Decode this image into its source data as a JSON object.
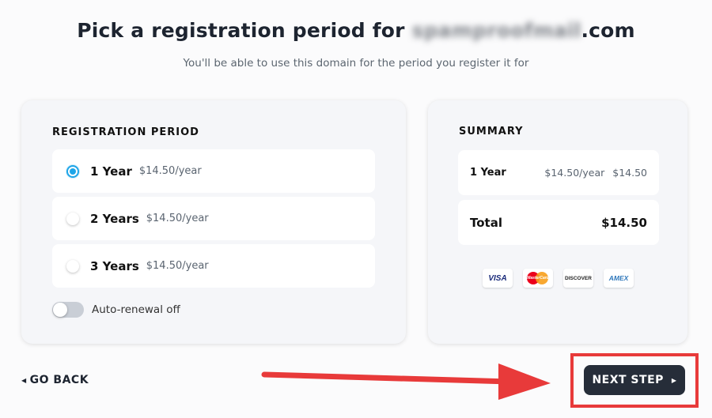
{
  "header": {
    "title_prefix": "Pick a registration period for ",
    "domain_blurred": "spamproofmail",
    "title_suffix": ".com",
    "subtitle": "You'll be able to use this domain for the period you register it for"
  },
  "registration": {
    "heading": "REGISTRATION PERIOD",
    "options": [
      {
        "label": "1 Year",
        "price": "$14.50/year",
        "selected": true
      },
      {
        "label": "2 Years",
        "price": "$14.50/year",
        "selected": false
      },
      {
        "label": "3 Years",
        "price": "$14.50/year",
        "selected": false
      }
    ],
    "auto_renewal_label": "Auto-renewal off",
    "auto_renewal_on": false
  },
  "summary": {
    "heading": "SUMMARY",
    "item": {
      "name": "1 Year",
      "rate": "$14.50/year",
      "amount": "$14.50"
    },
    "total": {
      "label": "Total",
      "amount": "$14.50"
    },
    "payments": [
      {
        "icon": "visa-icon",
        "text": "VISA"
      },
      {
        "icon": "mastercard-icon",
        "text": "MasterCard"
      },
      {
        "icon": "discover-icon",
        "text": "DISCOVER"
      },
      {
        "icon": "amex-icon",
        "text": "AMEX"
      }
    ]
  },
  "nav": {
    "back_label": "GO BACK",
    "next_label": "NEXT STEP"
  },
  "colors": {
    "accent": "#1ea5e8",
    "button": "#262d39",
    "annotation": "#e83a3a"
  }
}
